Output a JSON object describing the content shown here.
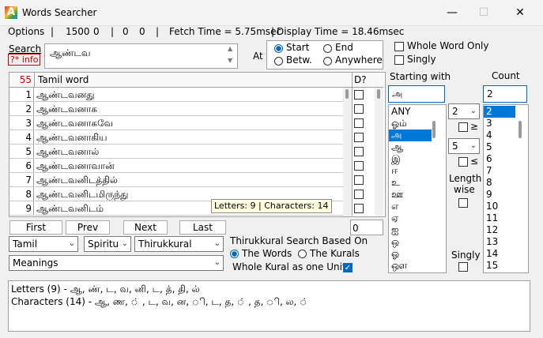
{
  "window": {
    "title": "Words Searcher",
    "icon_letter": "A",
    "minimize": "—",
    "maximize": "☐",
    "close": "✕"
  },
  "menubar": {
    "options": "Options",
    "sep1": "|",
    "v1": "1500",
    "v2": "0",
    "sep2": "|",
    "v3": "0",
    "v4": "0",
    "sep3": "|",
    "fetch": "Fetch Time = 5.75msec",
    "sep4": "|",
    "display": "Display Time = 18.46msec"
  },
  "search": {
    "label": "Search",
    "info": "?* info",
    "value": "ஆண்டவ",
    "at_label": "At",
    "radio_start": "Start",
    "radio_end": "End",
    "radio_betw": "Betw.",
    "radio_anywhere": "Anywhere",
    "selected_radio": "Start"
  },
  "options": {
    "whole_word_only": "Whole Word Only",
    "singly": "Singly"
  },
  "grid": {
    "count": "55",
    "header_word": "Tamil word",
    "header_d": "D?",
    "rows": [
      {
        "n": "1",
        "word": "ஆண்டவனது"
      },
      {
        "n": "2",
        "word": "ஆண்டவனாக"
      },
      {
        "n": "3",
        "word": "ஆண்டவனாகவே"
      },
      {
        "n": "4",
        "word": "ஆண்டவனாகிய"
      },
      {
        "n": "5",
        "word": "ஆண்டவனால்"
      },
      {
        "n": "6",
        "word": "ஆண்டவனாவான்"
      },
      {
        "n": "7",
        "word": "ஆண்டவனிடத்தில்"
      },
      {
        "n": "8",
        "word": "ஆண்டவனிடமிருந்து"
      },
      {
        "n": "9",
        "word": "ஆண்டவனிடம்"
      }
    ],
    "tooltip": "Letters: 9  |  Characters: 14"
  },
  "nav": {
    "first": "First",
    "prev": "Prev",
    "next": "Next",
    "last": "Last",
    "goto_value": "0"
  },
  "combos": {
    "language": "Tamil",
    "category": "Spiritu",
    "book": "Thirukkural",
    "meanings": "Meanings"
  },
  "thirukkural": {
    "label": "Thirukkural Search Based On",
    "the_words": "The Words",
    "the_kurals": "The Kurals",
    "whole_kural": "Whole Kural as one Unit"
  },
  "starting_with": {
    "label": "Starting with",
    "value": "அ",
    "items": [
      "ANY",
      "ஓம்",
      "அ",
      "ஆ",
      "இ",
      "ஈ",
      "உ",
      "ஊ",
      "எ",
      "ஏ",
      "ஐ",
      "ஒ",
      "ஓ",
      "ஔ"
    ],
    "selected": "அ"
  },
  "length": {
    "min": "2",
    "ge": "≥",
    "max": "5",
    "le": "≤",
    "length_label": "Length",
    "wise_label": "wise",
    "singly_label": "Singly"
  },
  "count_panel": {
    "label": "Count",
    "value": "2",
    "items": [
      "2",
      "3",
      "4",
      "5",
      "6",
      "7",
      "8",
      "9",
      "10",
      "11",
      "12",
      "13",
      "14",
      "15"
    ],
    "selected": "2"
  },
  "details": {
    "letters": "Letters (9) -  ஆ, ண், ட, வ, னி, ட, த், தி, ல்",
    "characters": "Characters (14) - ஆ, ண, ் , ட, வ, ன, ி, ட, த, ் , த, ி, ல, ்"
  }
}
